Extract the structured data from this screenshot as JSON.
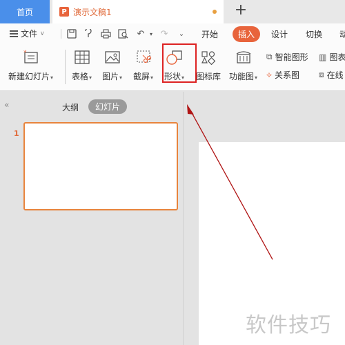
{
  "tabs": {
    "home": "首页",
    "document_title": "演示文稿1",
    "new_tab": "+"
  },
  "menu": {
    "file": "文件",
    "tabs": [
      "开始",
      "插入",
      "设计",
      "切换",
      "动"
    ],
    "active_tab": "插入"
  },
  "ribbon": {
    "new_slide": "新建幻灯片",
    "table": "表格",
    "picture": "图片",
    "screenshot": "截屏",
    "shape": "形状",
    "icon_library": "图标库",
    "function_chart": "功能图",
    "smart_shape": "智能图形",
    "relation_chart": "关系图",
    "chart_cut": "图表",
    "online_cut": "在线"
  },
  "left_pane": {
    "outline_tab": "大纲",
    "slides_tab": "幻灯片",
    "collapse": "«",
    "slide_number": "1"
  },
  "watermark": "软件技巧",
  "colors": {
    "accent": "#e8643c",
    "home_tab": "#4a8fea",
    "highlight_box": "#dd2222",
    "annotation_arrow": "#b01515"
  }
}
